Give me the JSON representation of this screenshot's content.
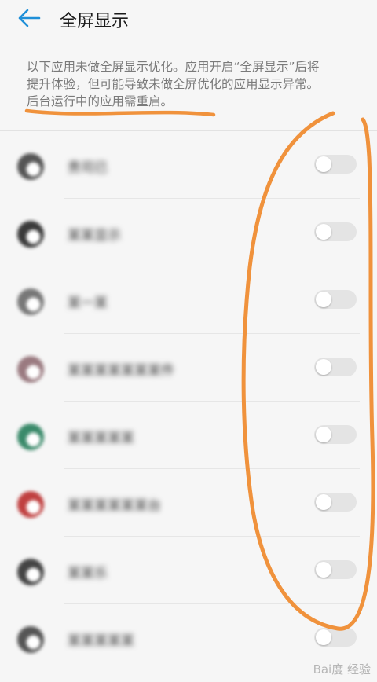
{
  "header": {
    "title": "全屏显示",
    "back_icon": "arrow-left-icon",
    "accent": "#1f8fd8"
  },
  "description": {
    "line1": "以下应用未做全屏显示优化。应用开启“全屏显示”后将",
    "line2": "提升体验，但可能导致未做全屏优化的应用显示异常。",
    "line3": "后台运行中的应用需重启。"
  },
  "apps": [
    {
      "name": "贵司已",
      "enabled": false,
      "icon_color": "#555555"
    },
    {
      "name": "某某显示",
      "enabled": false,
      "icon_color": "#3a3a3a"
    },
    {
      "name": "某一某",
      "enabled": false,
      "icon_color": "#777777"
    },
    {
      "name": "某某某某某某某件",
      "enabled": false,
      "icon_color": "#9a7a80"
    },
    {
      "name": "某某某某某",
      "enabled": false,
      "icon_color": "#3a8a6a"
    },
    {
      "name": "某某某某某某台",
      "enabled": false,
      "icon_color": "#c04040"
    },
    {
      "name": "某某乐",
      "enabled": false,
      "icon_color": "#444444"
    },
    {
      "name": "某某某某某",
      "enabled": false,
      "icon_color": "#555555"
    }
  ],
  "annotation": {
    "color": "#f0923c"
  },
  "watermark": "Bai度 经验"
}
